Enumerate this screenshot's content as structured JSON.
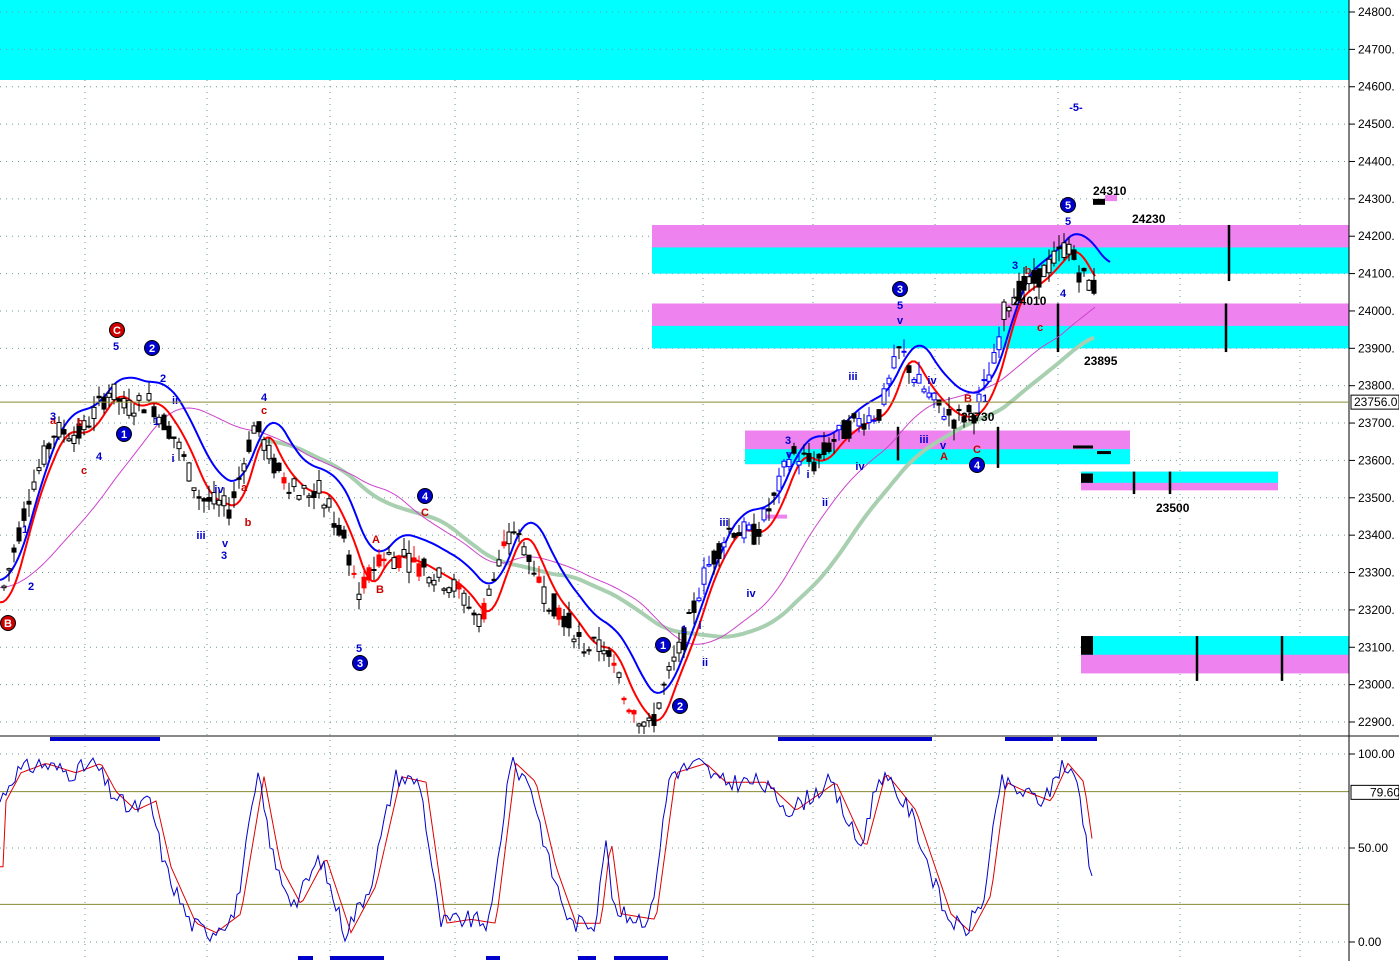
{
  "chart_data": [
    {
      "type": "candlestick",
      "title": "",
      "ylim": [
        22900,
        24800
      ],
      "y_ticks": [
        "24800.",
        "24700.",
        "24600.",
        "24500.",
        "24400.",
        "24300.",
        "24200.",
        "24100.",
        "24000.",
        "23900.",
        "23800.",
        "23700.",
        "23600.",
        "23500.",
        "23400.",
        "23300.",
        "23200.",
        "23100.",
        "23000.",
        "22900."
      ],
      "current_price_label": "23756.0",
      "current_price": 23756,
      "grid": true,
      "price_levels": [
        {
          "label": "24310",
          "value": 24310
        },
        {
          "label": "24230",
          "value": 24230
        },
        {
          "label": "23895",
          "value": 23895
        },
        {
          "label": "23500",
          "value": 23500
        },
        {
          "label": "24010",
          "value": 24010
        },
        {
          "label": "23730",
          "value": 23730
        }
      ],
      "zones": [
        {
          "from": 24100,
          "to": 24230,
          "color": "#ee82ee"
        },
        {
          "from": 24100,
          "to": 24170,
          "color": "#00ffff"
        },
        {
          "from": 23900,
          "to": 24020,
          "color": "#ee82ee"
        },
        {
          "from": 23900,
          "to": 23960,
          "color": "#00ffff"
        },
        {
          "from": 23590,
          "to": 23680,
          "color": "#ee82ee"
        },
        {
          "from": 23590,
          "to": 23630,
          "color": "#00ffff"
        },
        {
          "from": 23520,
          "to": 23570,
          "color": "#ee82ee"
        },
        {
          "from": 23540,
          "to": 23570,
          "color": "#00ffff"
        },
        {
          "from": 23030,
          "to": 23130,
          "color": "#ee82ee"
        },
        {
          "from": 23080,
          "to": 23130,
          "color": "#00ffff"
        }
      ],
      "wave_labels": {
        "circled": [
          "B",
          "C",
          "2",
          "1",
          "3",
          "1",
          "2",
          "3",
          "4",
          "4",
          "5"
        ],
        "text": [
          "a",
          "b",
          "c",
          "1",
          "2",
          "3",
          "4",
          "5",
          "i",
          "ii",
          "iii",
          "iv",
          "v",
          "A",
          "B",
          "C",
          "-5-"
        ]
      },
      "series_colors": {
        "price": "#000000",
        "ma_fast": "#ff0000",
        "ma_slow": "#0000ff",
        "ma_long": "#cc44cc",
        "ma_longest": "#a8d0b0",
        "zone_cyan": "#00ffff",
        "zone_magenta": "#ee82ee"
      }
    },
    {
      "type": "line",
      "title": "",
      "ylim": [
        0,
        100
      ],
      "y_ticks": [
        "100.00",
        "50.00",
        "0.00"
      ],
      "current_value_label": "79.60",
      "current_value": 79.6,
      "reference_lines": [
        80,
        20
      ],
      "series_colors": {
        "k": "#0000cc",
        "d": "#dd0000"
      }
    }
  ]
}
